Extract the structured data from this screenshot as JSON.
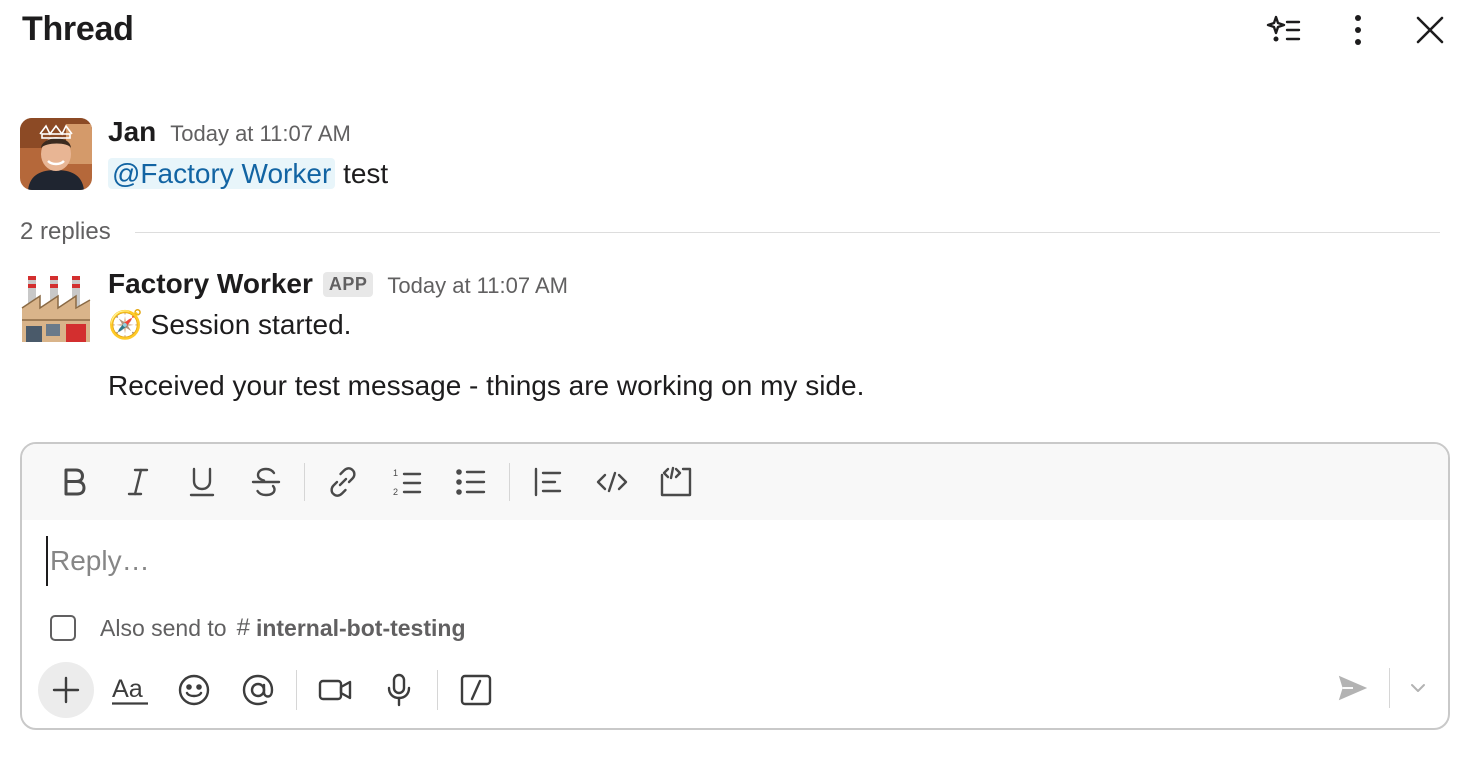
{
  "header": {
    "title": "Thread",
    "icons": [
      "ai-summary-icon",
      "more-vertical-icon",
      "close-icon"
    ]
  },
  "parent_message": {
    "author": "Jan",
    "timestamp": "Today at 11:07 AM",
    "mention": "@Factory Worker",
    "text": "test"
  },
  "replies": {
    "label": "2 replies"
  },
  "reply_message": {
    "author": "Factory Worker",
    "badge": "APP",
    "timestamp": "Today at 11:07 AM",
    "emoji": "🧭",
    "line1": "Session started.",
    "line2": "Received your test message - things are working on my side."
  },
  "composer": {
    "placeholder": "Reply…",
    "also_send_label": "Also send to",
    "hash": "#",
    "channel": "internal-bot-testing",
    "format_tools": [
      "bold-icon",
      "italic-icon",
      "underline-icon",
      "strikethrough-icon",
      "link-icon",
      "ordered-list-icon",
      "bulleted-list-icon",
      "blockquote-icon",
      "code-icon",
      "code-block-icon"
    ],
    "bottom_tools": [
      "plus-icon",
      "formatting-icon",
      "emoji-icon",
      "mention-icon",
      "video-icon",
      "microphone-icon",
      "slash-command-icon",
      "send-icon",
      "chevron-down-icon"
    ],
    "formatting_label": "Aa"
  },
  "colors": {
    "mention_bg": "#e8f5fa",
    "mention_text": "#1264a3",
    "muted_text": "#616061",
    "composer_border": "#c9c9c9"
  }
}
